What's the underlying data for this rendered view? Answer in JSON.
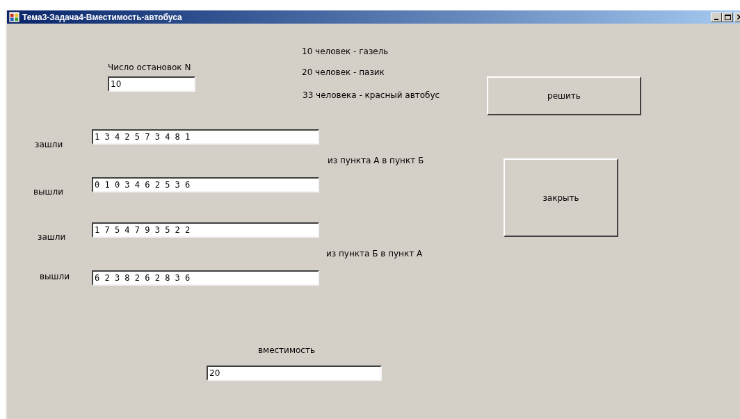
{
  "window": {
    "title": "Тема3-Задача4-Вместимость-автобуса"
  },
  "controls": [
    {
      "kind": "label",
      "text": "Число остановок N"
    },
    {
      "kind": "field",
      "value": "10"
    },
    {
      "kind": "label",
      "text": "10 человек - газель"
    },
    {
      "kind": "label",
      "text": "20 человек - пазик"
    },
    {
      "kind": "label",
      "text": "33 человека - красный автобус"
    },
    {
      "kind": "button",
      "text": "решить"
    },
    {
      "kind": "label",
      "text": "зашли"
    },
    {
      "kind": "field",
      "value": "1 3 4 2 5 7 3 4 8 1"
    },
    {
      "kind": "label",
      "text": "из пункта А в пункт Б"
    },
    {
      "kind": "label",
      "text": "вышли"
    },
    {
      "kind": "field",
      "value": "0 1 0 3 4 6 2 5 3 6"
    },
    {
      "kind": "button",
      "text": "закрыть"
    },
    {
      "kind": "label",
      "text": "зашли"
    },
    {
      "kind": "field",
      "value": "1 7 5 4 7 9 3 5 2 2"
    },
    {
      "kind": "label",
      "text": "из пункта Б в пункт А"
    },
    {
      "kind": "label",
      "text": "вышли"
    },
    {
      "kind": "field",
      "value": "6 2 3 8 2 6 2 8 3 6"
    },
    {
      "kind": "label",
      "text": "вместимость"
    },
    {
      "kind": "field",
      "value": "20"
    }
  ]
}
